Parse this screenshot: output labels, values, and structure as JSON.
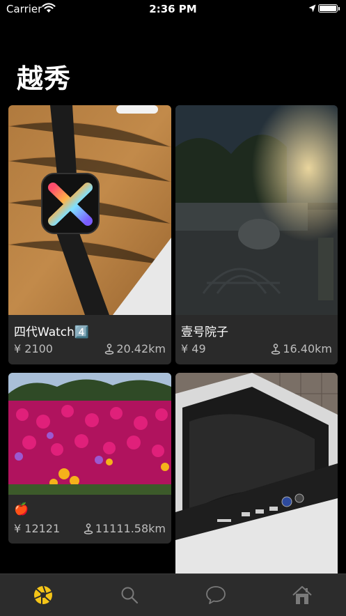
{
  "status_bar": {
    "carrier": "Carrier",
    "time": "2:36 PM",
    "battery_level": 1.0
  },
  "page": {
    "title": "越秀"
  },
  "items": [
    {
      "name": "四代Watch4️⃣",
      "price": "¥ 2100",
      "distance": "20.42km",
      "photo": "apple-watch-photo"
    },
    {
      "name": "壹号院子",
      "price": "¥ 49",
      "distance": "16.40km",
      "photo": "night-courtyard-photo"
    },
    {
      "name": "🍎",
      "price": "¥ 12121",
      "distance": "11111.58km",
      "photo": "pink-flowers-photo"
    },
    {
      "name": "",
      "price": "",
      "distance": "",
      "photo": "washing-machine-photo"
    }
  ],
  "tab_bar": {
    "tabs": [
      {
        "icon": "aperture-icon",
        "active": true
      },
      {
        "icon": "search-icon",
        "active": false
      },
      {
        "icon": "chat-bubble-icon",
        "active": false
      },
      {
        "icon": "home-icon",
        "active": false
      }
    ],
    "accent": "#f5c518",
    "inactive": "#7a7a7a"
  }
}
